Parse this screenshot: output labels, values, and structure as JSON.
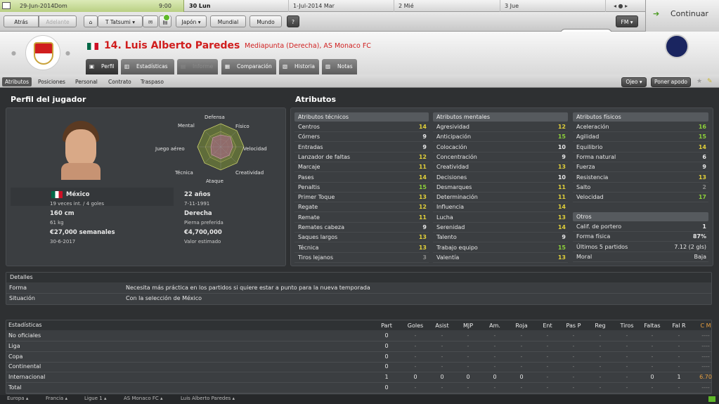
{
  "calendar": {
    "current_date": "29-Jun-2014",
    "current_day": "Dom",
    "time": "9:00",
    "days": [
      "30 Lun",
      "1-Jul-2014 Mar",
      "2 Mié",
      "3 Jue"
    ]
  },
  "nav": {
    "back": "Atrás",
    "forward": "Adelante",
    "manager": "T Tatsumi",
    "country": "Japón",
    "world": "Mundial",
    "world2": "Mundo",
    "help": "?",
    "fm": "FM"
  },
  "continue_label": "Continuar",
  "player": {
    "number_name": "14. Luis Alberto Paredes",
    "position_club": "Mediapunta (Derecha), AS Monaco FC"
  },
  "tabs": [
    "Perfil",
    "Estadísticas",
    "Informe",
    "Comparación",
    "Historia",
    "Notas"
  ],
  "subtabs": [
    "Atributos",
    "Posiciones",
    "Personal",
    "Contrato",
    "Traspaso"
  ],
  "toolbar": {
    "ojeo": "Ojeo",
    "apodo": "Poner apodo"
  },
  "profile": {
    "title": "Perfil del jugador",
    "radar_labels": [
      "Defensa",
      "Físico",
      "Velocidad",
      "Creatividad",
      "Ataque",
      "Técnica",
      "Juego aéreo",
      "Mental"
    ],
    "nation": "México",
    "caps": "19 veces int. / 4 goles",
    "age": "22 años",
    "dob": "7-11-1991",
    "height": "160 cm",
    "weight": "61 kg",
    "foot": "Derecha",
    "foot_label": "Pierna preferida",
    "wage": "€27,000 semanales",
    "contract": "30-6-2017",
    "value": "€4,700,000",
    "value_label": "Valor estimado"
  },
  "attributes_title": "Atributos",
  "technical": {
    "title": "Atributos técnicos",
    "items": [
      [
        "Centros",
        "14"
      ],
      [
        "Córners",
        "9"
      ],
      [
        "Entradas",
        "9"
      ],
      [
        "Lanzador de faltas",
        "12"
      ],
      [
        "Marcaje",
        "11"
      ],
      [
        "Pases",
        "14"
      ],
      [
        "Penaltis",
        "15"
      ],
      [
        "Primer Toque",
        "13"
      ],
      [
        "Regate",
        "12"
      ],
      [
        "Remate",
        "11"
      ],
      [
        "Remates cabeza",
        "9"
      ],
      [
        "Saques largos",
        "13"
      ],
      [
        "Técnica",
        "13"
      ],
      [
        "Tiros lejanos",
        "3"
      ]
    ]
  },
  "mental": {
    "title": "Atributos mentales",
    "items": [
      [
        "Agresividad",
        "12"
      ],
      [
        "Anticipación",
        "15"
      ],
      [
        "Colocación",
        "10"
      ],
      [
        "Concentración",
        "9"
      ],
      [
        "Creatividad",
        "13"
      ],
      [
        "Decisiones",
        "10"
      ],
      [
        "Desmarques",
        "11"
      ],
      [
        "Determinación",
        "11"
      ],
      [
        "Influencia",
        "14"
      ],
      [
        "Lucha",
        "13"
      ],
      [
        "Serenidad",
        "14"
      ],
      [
        "Talento",
        "9"
      ],
      [
        "Trabajo equipo",
        "15"
      ],
      [
        "Valentía",
        "13"
      ]
    ]
  },
  "physical": {
    "title": "Atributos físicos",
    "items": [
      [
        "Aceleración",
        "16"
      ],
      [
        "Agilidad",
        "15"
      ],
      [
        "Equilibrio",
        "14"
      ],
      [
        "Forma natural",
        "6"
      ],
      [
        "Fuerza",
        "9"
      ],
      [
        "Resistencia",
        "13"
      ],
      [
        "Salto",
        "2"
      ],
      [
        "Velocidad",
        "17"
      ]
    ]
  },
  "others": {
    "title": "Otros",
    "items": [
      [
        "Calif. de portero",
        "1"
      ],
      [
        "Forma física",
        "87%"
      ],
      [
        "Últimos 5 partidos",
        "7.12 (2 gls)"
      ],
      [
        "Moral",
        "Baja"
      ]
    ]
  },
  "details": {
    "title": "Detalles",
    "rows": [
      [
        "Forma",
        "Necesita más práctica en los partidos si quiere estar a punto para la nueva temporada"
      ],
      [
        "Situación",
        "Con la selección de México"
      ]
    ]
  },
  "stats": {
    "title": "Estadísticas",
    "headers": [
      "Part",
      "Goles",
      "Asist",
      "MJP",
      "Am.",
      "Roja",
      "Ent",
      "Pas P",
      "Reg",
      "Tiros",
      "Faltas",
      "Fal R",
      "C M"
    ],
    "rows": [
      [
        "No oficiales",
        "0",
        "-",
        "-",
        "-",
        "-",
        "-",
        "-",
        "-",
        "-",
        "-",
        "-",
        "-",
        "----"
      ],
      [
        "Liga",
        "0",
        "-",
        "-",
        "-",
        "-",
        "-",
        "-",
        "-",
        "-",
        "-",
        "-",
        "-",
        "----"
      ],
      [
        "Copa",
        "0",
        "-",
        "-",
        "-",
        "-",
        "-",
        "-",
        "-",
        "-",
        "-",
        "-",
        "-",
        "----"
      ],
      [
        "Continental",
        "0",
        "-",
        "-",
        "-",
        "-",
        "-",
        "-",
        "-",
        "-",
        "-",
        "-",
        "-",
        "----"
      ],
      [
        "Internacional",
        "1",
        "0",
        "0",
        "0",
        "0",
        "0",
        "-",
        "-",
        "-",
        "-",
        "0",
        "1",
        "6.70"
      ],
      [
        "Total",
        "0",
        "-",
        "-",
        "-",
        "-",
        "-",
        "-",
        "-",
        "-",
        "-",
        "-",
        "-",
        "----"
      ]
    ]
  },
  "breadcrumbs": [
    "Europa",
    "Francia",
    "Ligue 1",
    "AS Monaco FC",
    "Luis Alberto Paredes"
  ],
  "colors": {
    "red": "#d01e1e",
    "green": "#8dd13a",
    "yellow": "#e0d03a",
    "panel": "#3b3e41"
  }
}
